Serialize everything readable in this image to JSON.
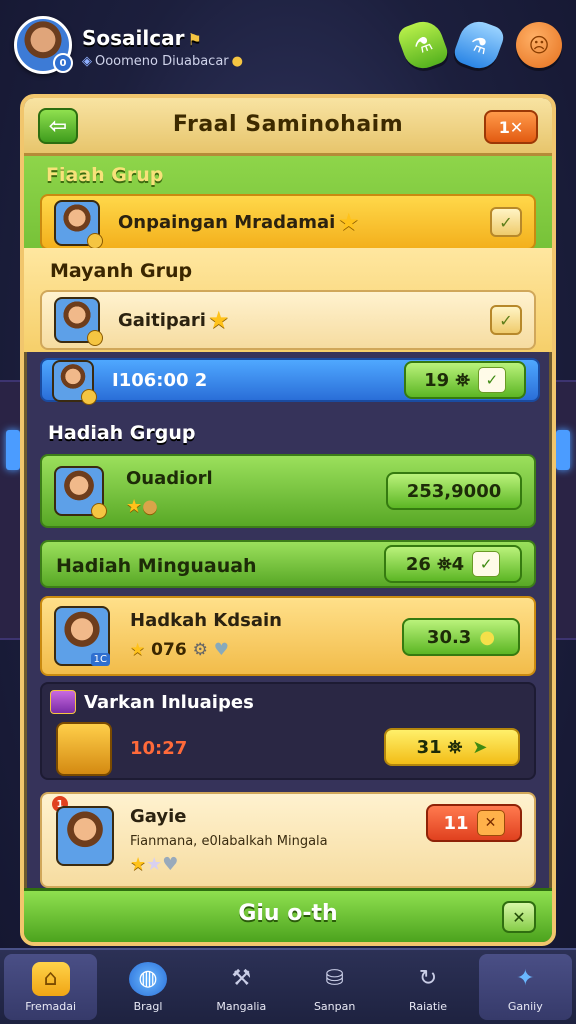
{
  "player": {
    "name": "Sosailcar",
    "subtext": "Ooomeno Diuabacar",
    "level_badge": "0"
  },
  "top_buttons": {
    "potion_green": "⚗",
    "potion_blue": "⚗",
    "emote": "☹"
  },
  "panel": {
    "title": "Fraal Saminohaim",
    "close_label": "1✕",
    "back_label": "⇦",
    "footer_title": "Giu o-th",
    "footer_close": "✕"
  },
  "sections": {
    "s1_label": "Fiaah Grup",
    "s2_label": "Mayanh Grup",
    "s3_label": "Hadiah Grgup",
    "s4_label": "Hadiah Minguauah",
    "s5_label": "Varkan Inluaipes"
  },
  "rows": {
    "r1": {
      "label": "Onpaingan Mradamai",
      "check": "✓"
    },
    "r2": {
      "label": "Gaitipari",
      "check": "✓"
    },
    "r3": {
      "label": "I106:00 2",
      "value": "19 ⛯",
      "check": "✓"
    },
    "r4": {
      "label": "Ouadiorl",
      "value": "253,9000"
    },
    "r5": {
      "value": "26 ⛯4",
      "check": "✓"
    },
    "r6": {
      "label": "Hadkah Kdsain",
      "rating": "076",
      "value": "30.3",
      "badge": "1C"
    },
    "r7": {
      "label": "10:27",
      "value": "31 ⛯"
    },
    "r8": {
      "label": "Gayie",
      "sub": "Fianmana, e0labalkah Mingala",
      "value": "11",
      "x": "✕",
      "tag": "1"
    }
  },
  "colors": {
    "panel_border": "#f1c66d",
    "accent_green": "#5fae26",
    "accent_yellow": "#f3b01c",
    "accent_blue": "#2a6ed8",
    "accent_red": "#e0411f"
  },
  "nav": [
    {
      "label": "Fremadai",
      "icon": "home-icon"
    },
    {
      "label": "Bragl",
      "icon": "globe-icon"
    },
    {
      "label": "Mangalia",
      "icon": "tools-icon"
    },
    {
      "label": "Sanpan",
      "icon": "bag-icon"
    },
    {
      "label": "Raiatie",
      "icon": "refresh-icon"
    },
    {
      "label": "Ganiiy",
      "icon": "gamepad-icon"
    }
  ]
}
